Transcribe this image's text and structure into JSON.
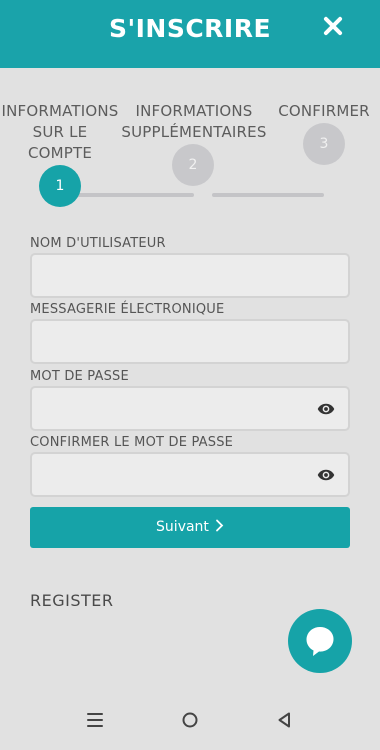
{
  "header": {
    "title": "S'INSCRIRE"
  },
  "stepper": {
    "steps": [
      {
        "number": "1",
        "label": "INFORMATIONS\nSUR LE\nCOMPTE",
        "state": "active"
      },
      {
        "number": "2",
        "label": "INFORMATIONS\nSUPPLÉMENTAIRES",
        "state": "inactive"
      },
      {
        "number": "3",
        "label": "CONFIRMER",
        "state": "inactive"
      }
    ]
  },
  "form": {
    "fields": [
      {
        "label": "NOM D'UTILISATEUR",
        "value": "",
        "type": "text"
      },
      {
        "label": "MESSAGERIE ÉLECTRONIQUE",
        "value": "",
        "type": "email"
      },
      {
        "label": "MOT DE PASSE",
        "value": "",
        "type": "password",
        "icon": "eye-icon"
      },
      {
        "label": "CONFIRMER LE MOT DE PASSE",
        "value": "",
        "type": "password",
        "icon": "eye-icon"
      }
    ],
    "next_label": "Suivant"
  },
  "register_link": "REGISTER",
  "colors": {
    "accent": "#16a3a8",
    "header": "#1aa3aa",
    "background": "#e1e1e1",
    "inactive_step": "#c8c8cb"
  },
  "icons": {
    "close": "close-icon",
    "chat": "chat-bubble-icon",
    "next": "chevron-right-icon",
    "nav": [
      "menu-icon",
      "home-circle-icon",
      "back-triangle-icon"
    ]
  }
}
